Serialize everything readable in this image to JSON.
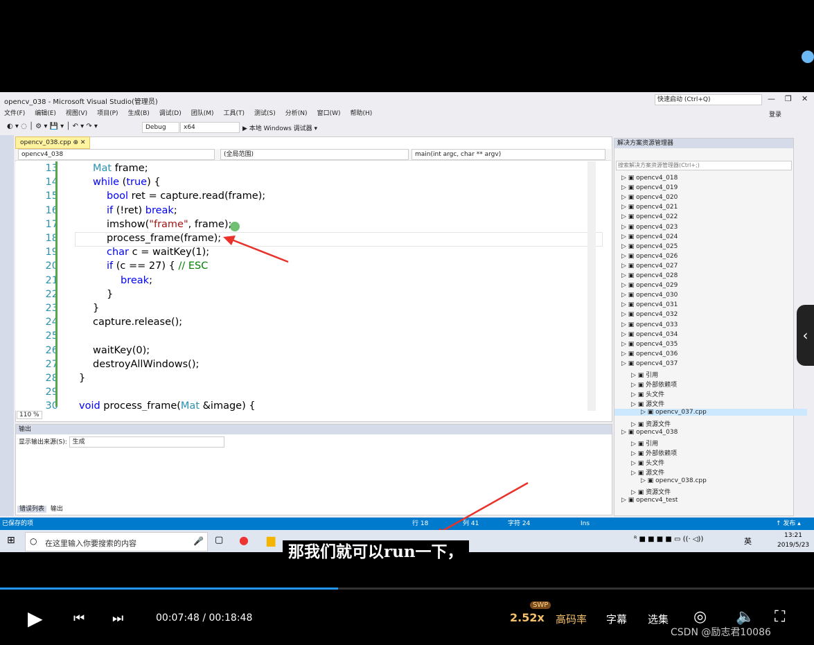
{
  "window": {
    "title": "opencv_038 - Microsoft Visual Studio(管理员)",
    "quick_launch": "快速启动 (Ctrl+Q)",
    "login": "登录"
  },
  "menu": [
    "文件(F)",
    "编辑(E)",
    "视图(V)",
    "项目(P)",
    "生成(B)",
    "调试(D)",
    "团队(M)",
    "工具(T)",
    "测试(S)",
    "分析(N)",
    "窗口(W)",
    "帮助(H)"
  ],
  "toolbar": {
    "config": "Debug",
    "platform": "x64",
    "run_label": "▶ 本地 Windows 调试器 ▾"
  },
  "editor": {
    "tab": "opencv_038.cpp",
    "nav_project": "opencv4_038",
    "nav_scope": "(全局范围)",
    "nav_function": "main(int argc, char ** argv)",
    "zoom": "110 %",
    "lines": [
      {
        "n": "13",
        "text": "Mat frame;"
      },
      {
        "n": "14",
        "text": "while (true) {"
      },
      {
        "n": "15",
        "text": "bool ret = capture.read(frame);"
      },
      {
        "n": "16",
        "text": "if (!ret) break;"
      },
      {
        "n": "17",
        "text": "imshow(\"frame\", frame);"
      },
      {
        "n": "18",
        "text": "process_frame(frame);"
      },
      {
        "n": "19",
        "text": "char c = waitKey(1);"
      },
      {
        "n": "20",
        "text": "if (c == 27) { // ESC"
      },
      {
        "n": "21",
        "text": "break;"
      },
      {
        "n": "22",
        "text": "}"
      },
      {
        "n": "23",
        "text": "}"
      },
      {
        "n": "24",
        "text": "capture.release();"
      },
      {
        "n": "25",
        "text": ""
      },
      {
        "n": "26",
        "text": "waitKey(0);"
      },
      {
        "n": "27",
        "text": "destroyAllWindows();"
      },
      {
        "n": "28",
        "text": "}"
      },
      {
        "n": "29",
        "text": ""
      },
      {
        "n": "30",
        "text": "void process_frame(Mat &image) {"
      }
    ]
  },
  "output": {
    "title": "输出",
    "source_label": "显示输出来源(S):",
    "source_value": "生成",
    "tabs": [
      "错误列表",
      "输出"
    ]
  },
  "solution": {
    "title": "解决方案资源管理器",
    "search": "搜索解决方案资源管理器(Ctrl+;)",
    "items": [
      "opencv4_018",
      "opencv4_019",
      "opencv4_020",
      "opencv4_021",
      "opencv4_022",
      "opencv4_023",
      "opencv4_024",
      "opencv4_025",
      "opencv4_026",
      "opencv4_027",
      "opencv4_028",
      "opencv4_029",
      "opencv4_030",
      "opencv4_031",
      "opencv4_032",
      "opencv4_033",
      "opencv4_034",
      "opencv4_035",
      "opencv4_036",
      "opencv4_037",
      "引用",
      "外部依赖项",
      "头文件",
      "源文件",
      "opencv_037.cpp",
      "资源文件",
      "opencv4_038",
      "引用",
      "外部依赖项",
      "头文件",
      "源文件",
      "opencv_038.cpp",
      "资源文件",
      "opencv4_test"
    ]
  },
  "status": {
    "saved": "已保存的项",
    "row": "行 18",
    "col": "列 41",
    "char": "字符 24",
    "mode": "Ins",
    "publish": "↑ 发布 ▴"
  },
  "taskbar": {
    "search": "在这里输入你要搜索的内容",
    "time": "13:21",
    "date": "2019/5/23",
    "lang": "英"
  },
  "subtitle": "那我们就可以run一下，",
  "player": {
    "time": "00:07:48 / 00:18:48",
    "progress": 0.415,
    "speed": "2.52x",
    "swp": "SWP",
    "quality": "高码率",
    "captions": "字幕",
    "episodes": "选集",
    "watermark": "CSDN @励志君10086"
  }
}
